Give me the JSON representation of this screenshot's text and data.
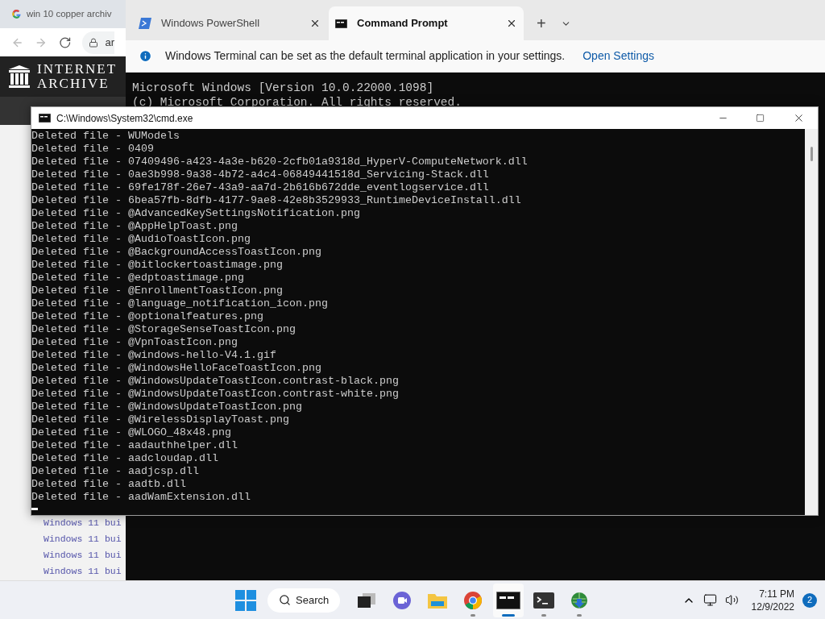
{
  "browser": {
    "tab_title": "win 10 copper archiv",
    "address": "ar",
    "logo_lines": [
      "INTERNET",
      "ARCHIVE"
    ],
    "list_rows": [
      "Windows 11 bui",
      "Windows 11 bui",
      "Windows 11 bui",
      "Windows 11 bui"
    ]
  },
  "terminal": {
    "tabs": [
      {
        "label": "Windows PowerShell",
        "kind": "powershell",
        "selected": false
      },
      {
        "label": "Command Prompt",
        "kind": "cmd",
        "selected": true
      }
    ],
    "new_tab": "+",
    "info": {
      "message": "Windows Terminal can be set as the default terminal application in your settings.",
      "link": "Open Settings"
    },
    "lines": [
      "Microsoft Windows [Version 10.0.22000.1098]",
      "(c) Microsoft Corporation. All rights reserved."
    ]
  },
  "cmd": {
    "title": "C:\\Windows\\System32\\cmd.exe",
    "lines": [
      "Deleted file - WUModels",
      "Deleted file - 0409",
      "Deleted file - 07409496-a423-4a3e-b620-2cfb01a9318d_HyperV-ComputeNetwork.dll",
      "Deleted file - 0ae3b998-9a38-4b72-a4c4-06849441518d_Servicing-Stack.dll",
      "Deleted file - 69fe178f-26e7-43a9-aa7d-2b616b672dde_eventlogservice.dll",
      "Deleted file - 6bea57fb-8dfb-4177-9ae8-42e8b3529933_RuntimeDeviceInstall.dll",
      "Deleted file - @AdvancedKeySettingsNotification.png",
      "Deleted file - @AppHelpToast.png",
      "Deleted file - @AudioToastIcon.png",
      "Deleted file - @BackgroundAccessToastIcon.png",
      "Deleted file - @bitlockertoastimage.png",
      "Deleted file - @edptoastimage.png",
      "Deleted file - @EnrollmentToastIcon.png",
      "Deleted file - @language_notification_icon.png",
      "Deleted file - @optionalfeatures.png",
      "Deleted file - @StorageSenseToastIcon.png",
      "Deleted file - @VpnToastIcon.png",
      "Deleted file - @windows-hello-V4.1.gif",
      "Deleted file - @WindowsHelloFaceToastIcon.png",
      "Deleted file - @WindowsUpdateToastIcon.contrast-black.png",
      "Deleted file - @WindowsUpdateToastIcon.contrast-white.png",
      "Deleted file - @WindowsUpdateToastIcon.png",
      "Deleted file - @WirelessDisplayToast.png",
      "Deleted file - @WLOGO_48x48.png",
      "Deleted file - aadauthhelper.dll",
      "Deleted file - aadcloudap.dll",
      "Deleted file - aadjcsp.dll",
      "Deleted file - aadtb.dll",
      "Deleted file - aadWamExtension.dll"
    ]
  },
  "taskbar": {
    "search": "Search",
    "apps": [
      {
        "kind": "taskview",
        "running": false,
        "active": false
      },
      {
        "kind": "chat",
        "running": false,
        "active": false
      },
      {
        "kind": "explorer",
        "running": false,
        "active": false
      },
      {
        "kind": "chrome",
        "running": true,
        "active": false
      },
      {
        "kind": "cmd",
        "running": true,
        "active": true
      },
      {
        "kind": "terminal",
        "running": true,
        "active": false
      },
      {
        "kind": "download",
        "running": true,
        "active": false
      }
    ],
    "time": "7:11 PM",
    "date": "12/9/2022",
    "notifications": "2"
  }
}
